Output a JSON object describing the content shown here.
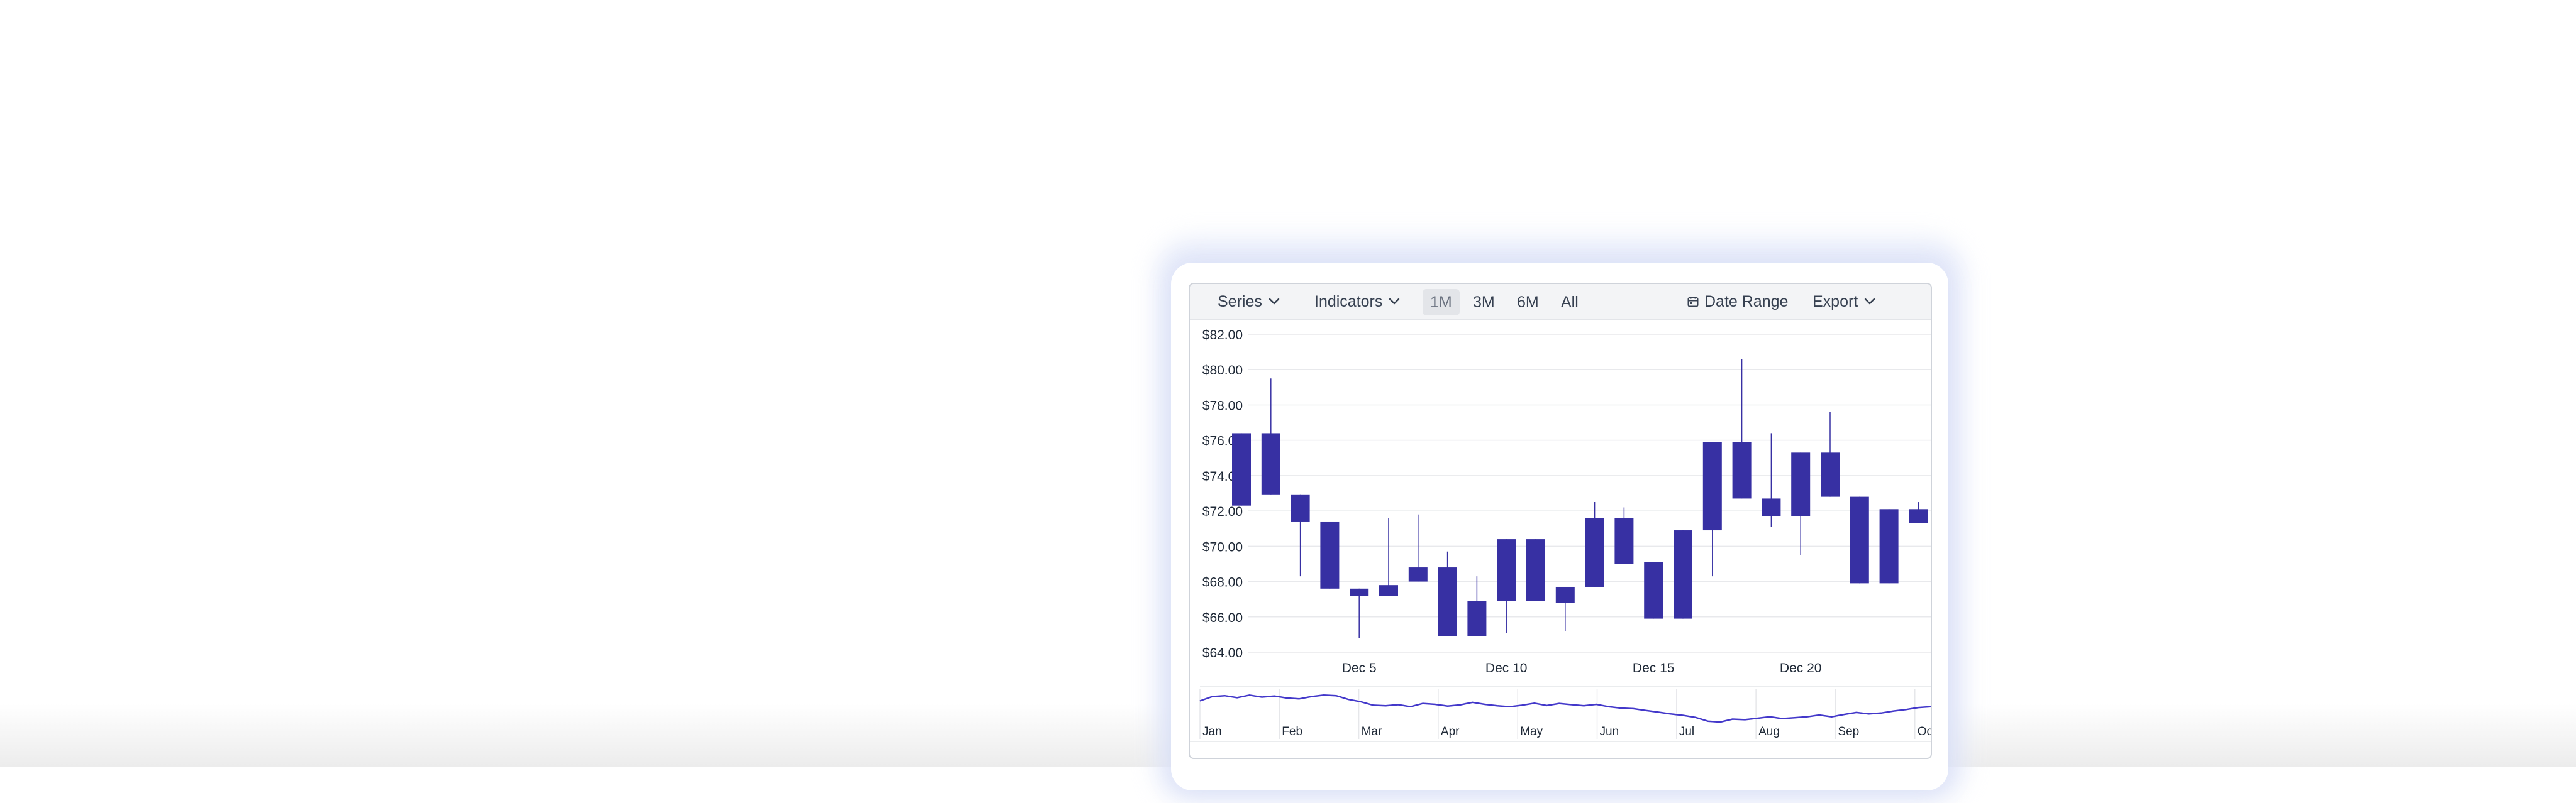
{
  "toolbar": {
    "series_label": "Series",
    "indicators_label": "Indicators",
    "ranges": [
      "1M",
      "3M",
      "6M",
      "All"
    ],
    "active_range": "1M",
    "date_range_label": "Date Range",
    "export_label": "Export"
  },
  "icons": {
    "dropdown": "chevron-down-icon",
    "date_range": "calendar-icon"
  },
  "colors": {
    "up": "#3730a3",
    "down": "#d1334c",
    "navigator_line": "#4338ca"
  },
  "chart_data": {
    "type": "candlestick",
    "ylim": [
      64,
      82
    ],
    "y_ticks": [
      82,
      80,
      78,
      76,
      74,
      72,
      70,
      68,
      66,
      64
    ],
    "y_tick_labels": [
      "$82.00",
      "$80.00",
      "$78.00",
      "$76.00",
      "$74.00",
      "$72.00",
      "$70.00",
      "$68.00",
      "$66.00",
      "$64.00"
    ],
    "x_tick_labels": [
      "Dec 5",
      "Dec 10",
      "Dec 15",
      "Dec 20"
    ],
    "x_tick_days": [
      5,
      10,
      15,
      20
    ],
    "candles": [
      {
        "day": 1,
        "open": 72.3,
        "high": 76.4,
        "low": 72.3,
        "close": 76.4
      },
      {
        "day": 2,
        "open": 72.9,
        "high": 79.5,
        "low": 72.9,
        "close": 76.4
      },
      {
        "day": 3,
        "open": 71.4,
        "high": 72.9,
        "low": 68.3,
        "close": 72.9
      },
      {
        "day": 4,
        "open": 67.6,
        "high": 71.4,
        "low": 67.6,
        "close": 71.4
      },
      {
        "day": 5,
        "open": 67.2,
        "high": 67.6,
        "low": 64.8,
        "close": 67.6
      },
      {
        "day": 6,
        "open": 67.2,
        "high": 71.6,
        "low": 67.2,
        "close": 67.8
      },
      {
        "day": 7,
        "open": 68.0,
        "high": 71.8,
        "low": 68.0,
        "close": 68.8
      },
      {
        "day": 8,
        "open": 64.9,
        "high": 69.7,
        "low": 64.9,
        "close": 68.8
      },
      {
        "day": 9,
        "open": 64.9,
        "high": 68.3,
        "low": 64.9,
        "close": 66.9
      },
      {
        "day": 10,
        "open": 66.9,
        "high": 70.4,
        "low": 65.1,
        "close": 70.4
      },
      {
        "day": 11,
        "open": 66.9,
        "high": 70.4,
        "low": 66.9,
        "close": 70.4
      },
      {
        "day": 12,
        "open": 66.8,
        "high": 67.7,
        "low": 65.2,
        "close": 67.7
      },
      {
        "day": 13,
        "open": 67.7,
        "high": 72.5,
        "low": 67.7,
        "close": 71.6
      },
      {
        "day": 14,
        "open": 69.0,
        "high": 72.2,
        "low": 69.0,
        "close": 71.6
      },
      {
        "day": 15,
        "open": 65.9,
        "high": 69.1,
        "low": 65.9,
        "close": 69.1
      },
      {
        "day": 16,
        "open": 65.9,
        "high": 70.9,
        "low": 65.9,
        "close": 70.9
      },
      {
        "day": 17,
        "open": 70.9,
        "high": 75.9,
        "low": 68.3,
        "close": 75.9
      },
      {
        "day": 18,
        "open": 72.7,
        "high": 80.6,
        "low": 72.7,
        "close": 75.9
      },
      {
        "day": 19,
        "open": 71.7,
        "high": 76.4,
        "low": 71.1,
        "close": 72.7
      },
      {
        "day": 20,
        "open": 71.7,
        "high": 75.3,
        "low": 69.5,
        "close": 75.3
      },
      {
        "day": 21,
        "open": 72.8,
        "high": 77.6,
        "low": 72.8,
        "close": 75.3
      },
      {
        "day": 22,
        "open": 67.9,
        "high": 72.8,
        "low": 67.9,
        "close": 72.8
      },
      {
        "day": 23,
        "open": 67.9,
        "high": 72.1,
        "low": 67.9,
        "close": 72.1
      },
      {
        "day": 24,
        "open": 71.3,
        "high": 72.5,
        "low": 71.3,
        "close": 72.1
      }
    ],
    "navigator": {
      "labels": [
        "Jan",
        "Feb",
        "Mar",
        "Apr",
        "May",
        "Jun",
        "Jul",
        "Aug",
        "Sep",
        "Oct"
      ],
      "values": [
        0.75,
        0.9,
        0.93,
        0.86,
        0.95,
        0.88,
        0.92,
        0.85,
        0.82,
        0.9,
        0.95,
        0.93,
        0.8,
        0.72,
        0.6,
        0.58,
        0.62,
        0.55,
        0.66,
        0.63,
        0.57,
        0.61,
        0.7,
        0.63,
        0.58,
        0.55,
        0.6,
        0.67,
        0.59,
        0.66,
        0.62,
        0.58,
        0.63,
        0.55,
        0.5,
        0.48,
        0.42,
        0.36,
        0.3,
        0.25,
        0.18,
        0.05,
        0.02,
        0.12,
        0.1,
        0.15,
        0.2,
        0.14,
        0.17,
        0.2,
        0.26,
        0.2,
        0.28,
        0.35,
        0.3,
        0.33,
        0.4,
        0.45,
        0.52,
        0.55
      ]
    }
  }
}
